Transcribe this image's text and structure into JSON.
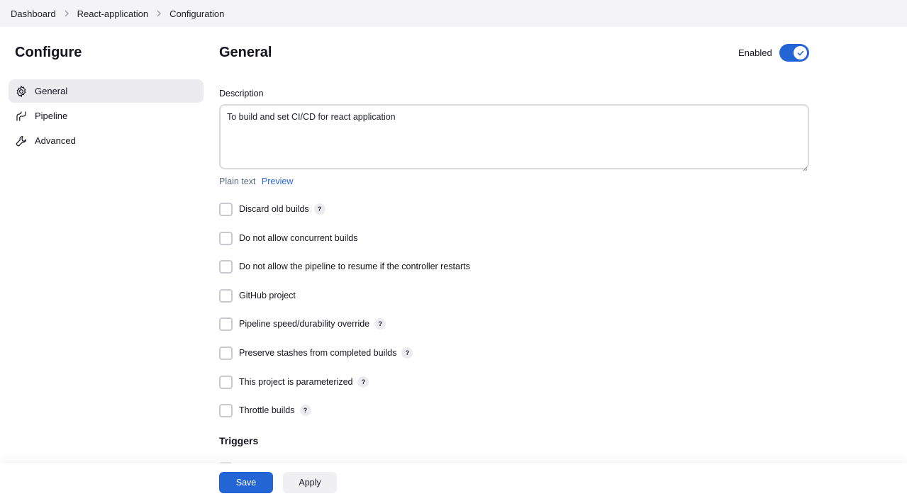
{
  "breadcrumb": [
    "Dashboard",
    "React-application",
    "Configuration"
  ],
  "sidebar": {
    "title": "Configure",
    "items": [
      {
        "label": "General",
        "icon": "gear-icon",
        "active": true
      },
      {
        "label": "Pipeline",
        "icon": "pipeline-icon",
        "active": false
      },
      {
        "label": "Advanced",
        "icon": "wrench-icon",
        "active": false
      }
    ]
  },
  "general": {
    "title": "General",
    "enabled_label": "Enabled",
    "enabled": true,
    "description_label": "Description",
    "description_value": "To build and set CI/CD for react application",
    "format_plain": "Plain text",
    "format_preview": "Preview",
    "options": [
      {
        "label": "Discard old builds",
        "help": true,
        "checked": false
      },
      {
        "label": "Do not allow concurrent builds",
        "help": false,
        "checked": false
      },
      {
        "label": "Do not allow the pipeline to resume if the controller restarts",
        "help": false,
        "checked": false
      },
      {
        "label": "GitHub project",
        "help": false,
        "checked": false
      },
      {
        "label": "Pipeline speed/durability override",
        "help": true,
        "checked": false
      },
      {
        "label": "Preserve stashes from completed builds",
        "help": true,
        "checked": false
      },
      {
        "label": "This project is parameterized",
        "help": true,
        "checked": false
      },
      {
        "label": "Throttle builds",
        "help": true,
        "checked": false
      }
    ],
    "help_glyph": "?"
  },
  "triggers": {
    "title": "Triggers"
  },
  "actions": {
    "save_label": "Save",
    "apply_label": "Apply"
  },
  "colors": {
    "accent": "#2465d6",
    "sidebar_active": "#ebebf0",
    "breadcrumb_bg": "#f4f4f6"
  }
}
